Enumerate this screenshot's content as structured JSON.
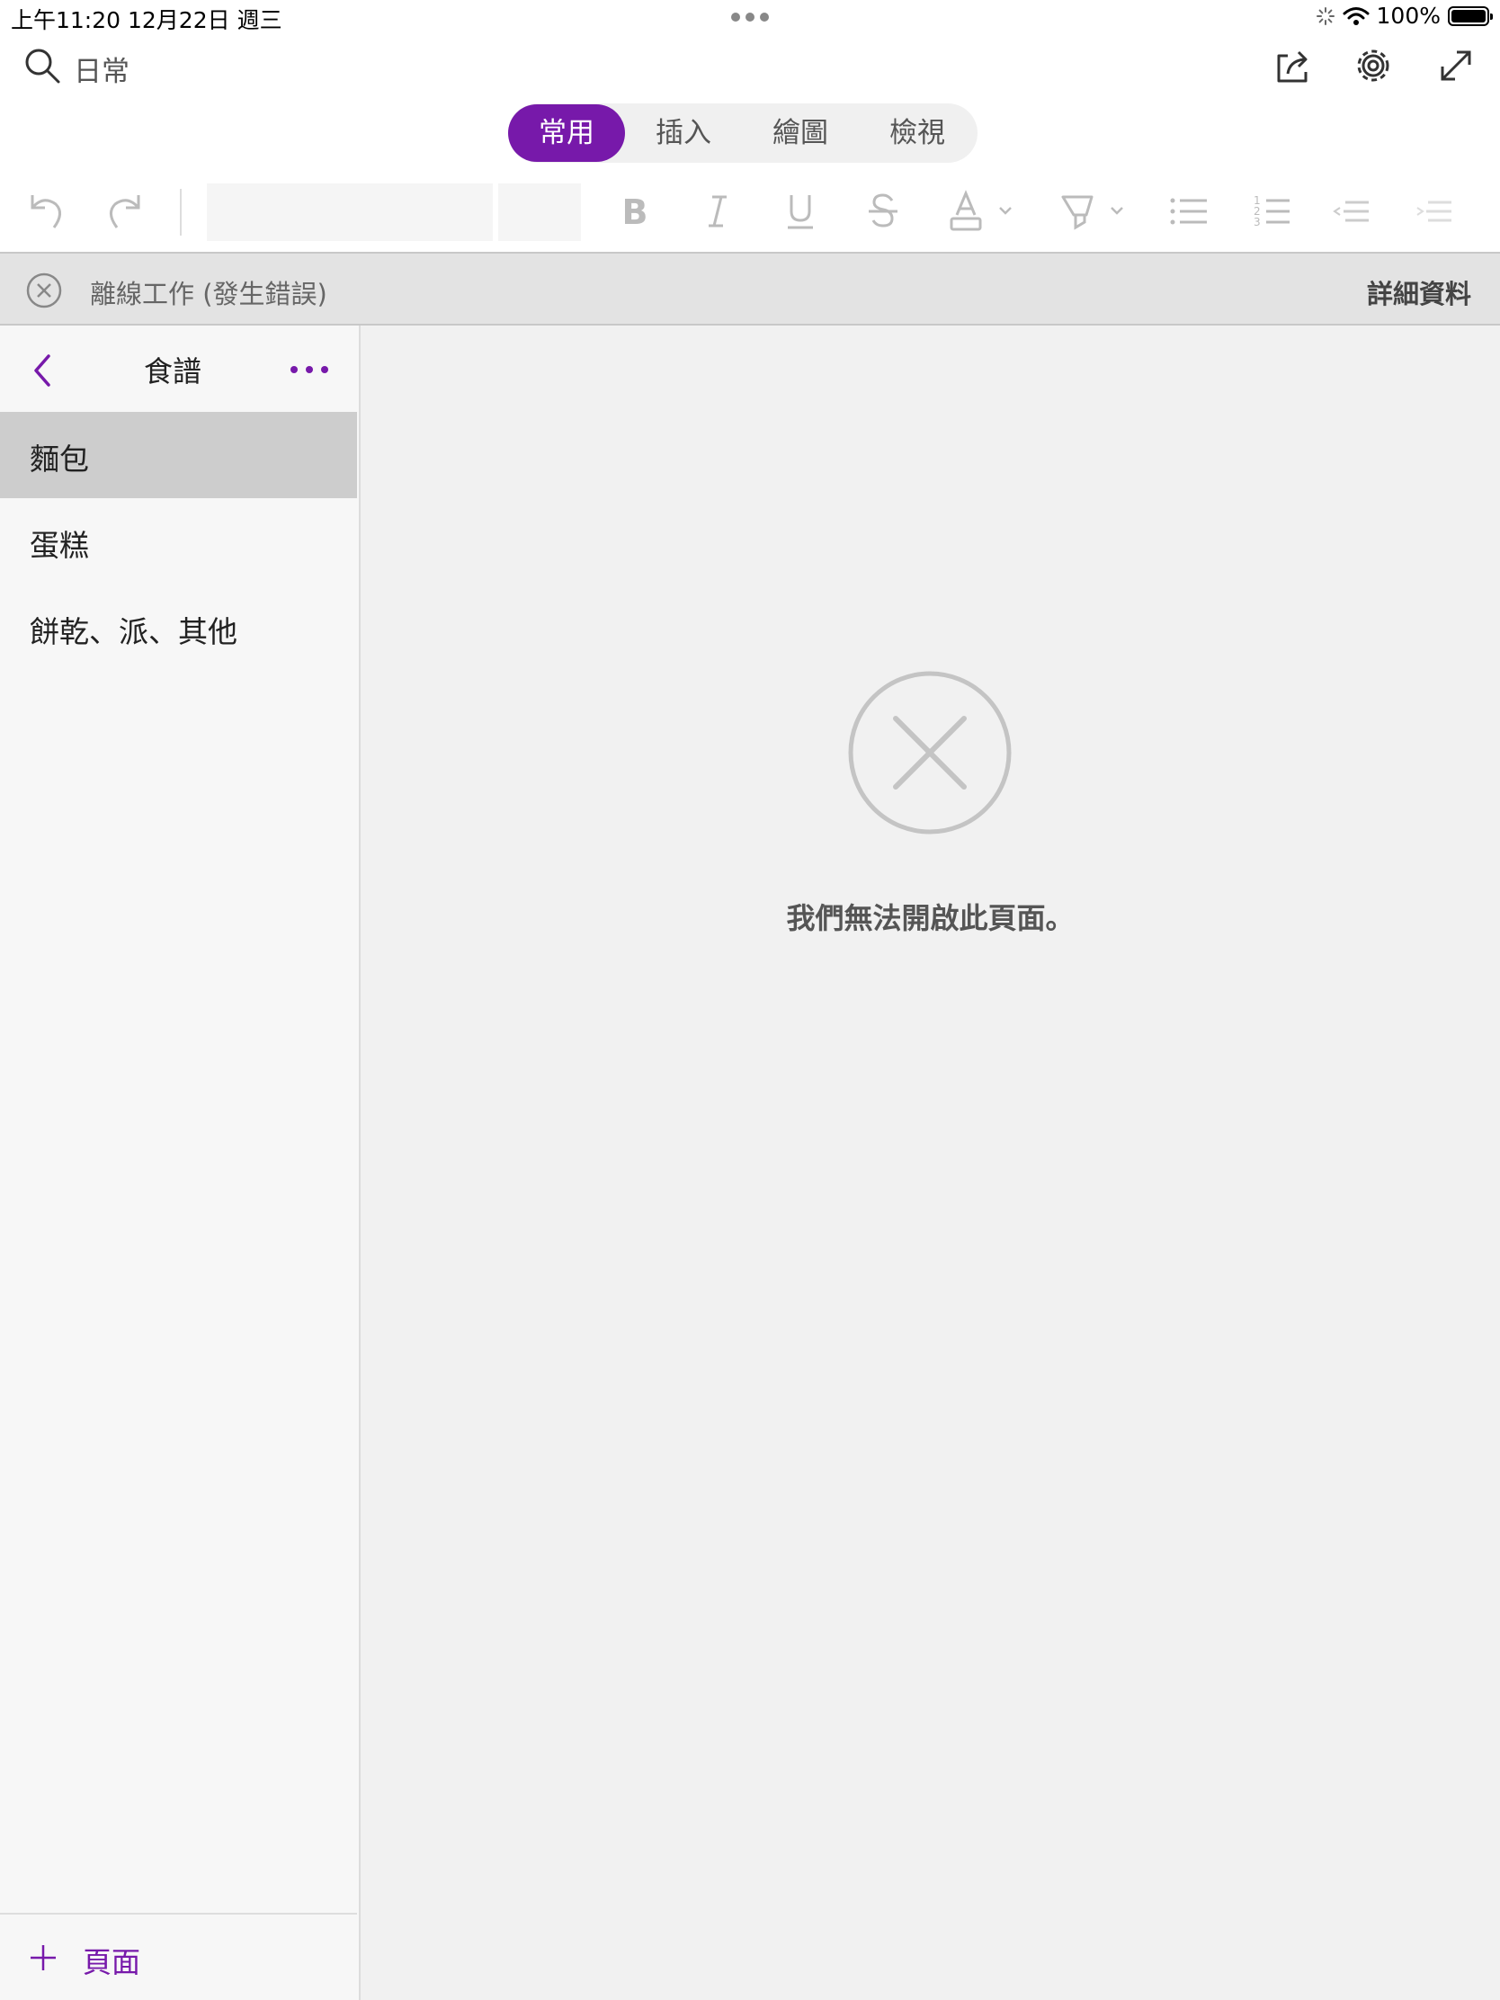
{
  "status_bar": {
    "time": "上午11:20   12月22日 週三",
    "battery": "100%"
  },
  "header": {
    "notebook_title": "日常"
  },
  "tabs": [
    {
      "label": "常用",
      "active": true
    },
    {
      "label": "插入",
      "active": false
    },
    {
      "label": "繪圖",
      "active": false
    },
    {
      "label": "檢視",
      "active": false
    }
  ],
  "banner": {
    "text": "離線工作 (發生錯誤)",
    "link": "詳細資料"
  },
  "sidebar": {
    "section_title": "食譜",
    "pages": [
      {
        "label": "麵包",
        "selected": true
      },
      {
        "label": "蛋糕",
        "selected": false
      },
      {
        "label": "餅乾、派、其他",
        "selected": false
      }
    ],
    "add_label": "頁面"
  },
  "main": {
    "error_message": "我們無法開啟此頁面。"
  },
  "colors": {
    "accent": "#7719aa",
    "banner_bg": "#e3e3e3",
    "sidebar_bg": "#f7f7f7",
    "selected_bg": "#cdcdcd"
  }
}
